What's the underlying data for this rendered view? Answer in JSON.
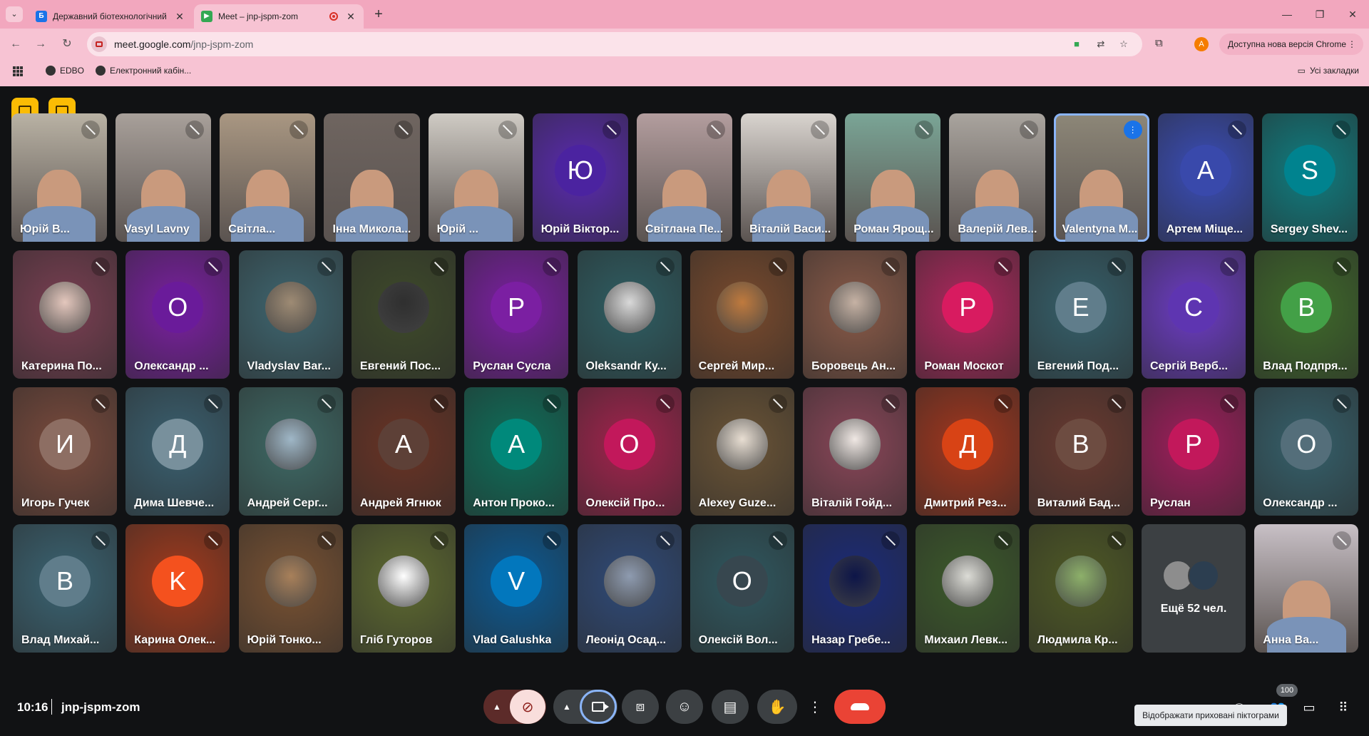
{
  "browser": {
    "tabs": [
      {
        "title": "Державний біотехнологічний",
        "favicon": "site-icon"
      },
      {
        "title": "Meet – jnp-jspm-zom",
        "favicon": "meet-icon",
        "recording": true
      }
    ],
    "url_host": "meet.google.com",
    "url_path": "/jnp-jspm-zom",
    "update_label": "Доступна нова версія Chrome",
    "profile_letter": "A",
    "bookmarks": [
      "EDBO",
      "Електронний кабін..."
    ],
    "all_bookmarks": "Усі закладки",
    "accent": "#f7c3d3"
  },
  "meet": {
    "time": "10:16",
    "meeting_code": "jnp-jspm-zom",
    "participants_count": "100",
    "tooltip": "Відображати приховані піктограми",
    "more_people_label": "Ещё 52 чел.",
    "participants": [
      {
        "name": "Юрій В...",
        "type": "video",
        "bg": "#b9b2a4"
      },
      {
        "name": "Vasyl Lavny",
        "type": "video",
        "bg": "#a8a09a"
      },
      {
        "name": "Світла...",
        "type": "video",
        "bg": "#a99782"
      },
      {
        "name": "Інна Микола...",
        "type": "video",
        "bg": "#6f6560"
      },
      {
        "name": "Юрій ...",
        "type": "video",
        "bg": "#cfcbc4"
      },
      {
        "name": "Юрій Віктор...",
        "type": "letter",
        "letter": "Ю",
        "bg": "#5a2ab0",
        "av": "#4b23a0"
      },
      {
        "name": "Світлана Пе...",
        "type": "video",
        "bg": "#b39d9e"
      },
      {
        "name": "Віталій Васи...",
        "type": "video",
        "bg": "#d9d4cf"
      },
      {
        "name": "Роман Ярощ...",
        "type": "video",
        "bg": "#7aa596"
      },
      {
        "name": "Валерій Лев...",
        "type": "video",
        "bg": "#a9a49e"
      },
      {
        "name": "Valentyna M...",
        "type": "video",
        "bg": "#8d8778",
        "speaking": true
      },
      {
        "name": "Артем Міще...",
        "type": "letter",
        "letter": "A",
        "bg": "#3a4db8",
        "av": "#3949ab"
      },
      {
        "name": "Sergey Shev...",
        "type": "letter",
        "letter": "S",
        "bg": "#0f7d80",
        "av": "#00838f"
      },
      {
        "name": "Катерина По...",
        "type": "photo",
        "bg": "#7a3f52",
        "av": "#e4c7bd"
      },
      {
        "name": "Олександр ...",
        "type": "letter",
        "letter": "O",
        "bg": "#7b1fa2",
        "av": "#6a1b9a"
      },
      {
        "name": "Vladyslav Bar...",
        "type": "photo",
        "bg": "#3e6670",
        "av": "#9e8b74"
      },
      {
        "name": "Евгений Пос...",
        "type": "photo",
        "bg": "#3e4a2a",
        "av": "#2f2f2f"
      },
      {
        "name": "Руслан Сусла",
        "type": "letter",
        "letter": "P",
        "bg": "#7b1fa2",
        "av": "#7b1fa2"
      },
      {
        "name": "Oleksandr Ку...",
        "type": "photo",
        "bg": "#2e5e63",
        "av": "#d9d9d9"
      },
      {
        "name": "Сергей Мир...",
        "type": "photo",
        "bg": "#7a4a2c",
        "av": "#bf7a3e"
      },
      {
        "name": "Боровець Ан...",
        "type": "photo",
        "bg": "#8a5a48",
        "av": "#c6b2a4"
      },
      {
        "name": "Роман Москот",
        "type": "letter",
        "letter": "P",
        "bg": "#b0285e",
        "av": "#d81b60"
      },
      {
        "name": "Евгений Под...",
        "type": "letter",
        "letter": "E",
        "bg": "#35606b",
        "av": "#607d8b"
      },
      {
        "name": "Сергій Верб...",
        "type": "letter",
        "letter": "C",
        "bg": "#6c3cc4",
        "av": "#5e35b1"
      },
      {
        "name": "Влад Подпря...",
        "type": "letter",
        "letter": "B",
        "bg": "#3f6a2a",
        "av": "#43a047"
      },
      {
        "name": "Игорь Гучек",
        "type": "letter",
        "letter": "И",
        "bg": "#7a4a3c",
        "av": "#8d6e63"
      },
      {
        "name": "Дима Шевче...",
        "type": "letter",
        "letter": "Д",
        "bg": "#3a6070",
        "av": "#78909c"
      },
      {
        "name": "Андрей Серг...",
        "type": "photo",
        "bg": "#3e6a66",
        "av": "#9fb7c7"
      },
      {
        "name": "Андрей Ягнюк",
        "type": "letter",
        "letter": "A",
        "bg": "#6a3324",
        "av": "#5d4037"
      },
      {
        "name": "Антон Проко...",
        "type": "letter",
        "letter": "A",
        "bg": "#0d6f5a",
        "av": "#00897b"
      },
      {
        "name": "Олексій Про...",
        "type": "letter",
        "letter": "O",
        "bg": "#a3234d",
        "av": "#c2185b"
      },
      {
        "name": "Alexey Guze...",
        "type": "photo",
        "bg": "#6b5436",
        "av": "#e8ded2"
      },
      {
        "name": "Віталій Гойд...",
        "type": "photo",
        "bg": "#8a4658",
        "av": "#f0e8e4"
      },
      {
        "name": "Дмитрий Рез...",
        "type": "letter",
        "letter": "Д",
        "bg": "#a2361d",
        "av": "#d84315"
      },
      {
        "name": "Виталий Бад...",
        "type": "letter",
        "letter": "B",
        "bg": "#6a3a30",
        "av": "#6d4c41"
      },
      {
        "name": "Руслан",
        "type": "letter",
        "letter": "P",
        "bg": "#a01d5c",
        "av": "#c2185b"
      },
      {
        "name": "Олександр ...",
        "type": "letter",
        "letter": "O",
        "bg": "#35606b",
        "av": "#546e7a"
      },
      {
        "name": "Влад Михай...",
        "type": "letter",
        "letter": "B",
        "bg": "#3a6372",
        "av": "#607d8b"
      },
      {
        "name": "Карина Олек...",
        "type": "letter",
        "letter": "K",
        "bg": "#a33a1c",
        "av": "#f4511e"
      },
      {
        "name": "Юрій Тонко...",
        "type": "photo",
        "bg": "#7a5232",
        "av": "#a8805a"
      },
      {
        "name": "Гліб Гуторов",
        "type": "photo",
        "bg": "#5e6a30",
        "av": "#ffffff"
      },
      {
        "name": "Vlad Galushka",
        "type": "letter",
        "letter": "V",
        "bg": "#0b5a94",
        "av": "#0277bd"
      },
      {
        "name": "Леонід Осад...",
        "type": "photo",
        "bg": "#2f4a78",
        "av": "#8e9bb0"
      },
      {
        "name": "Олексій Вол...",
        "type": "letter",
        "letter": "O",
        "bg": "#2f5860",
        "av": "#37474f"
      },
      {
        "name": "Назар Гребе...",
        "type": "photo",
        "bg": "#1a2a7a",
        "av": "#0d1548"
      },
      {
        "name": "Михаил Левк...",
        "type": "photo",
        "bg": "#3c5a2a",
        "av": "#dcdcd6"
      },
      {
        "name": "Людмила Кр...",
        "type": "photo",
        "bg": "#4f5a24",
        "av": "#8db06a"
      },
      {
        "name": "Анна Ва...",
        "type": "video",
        "bg": "#c8c0c6"
      }
    ]
  }
}
